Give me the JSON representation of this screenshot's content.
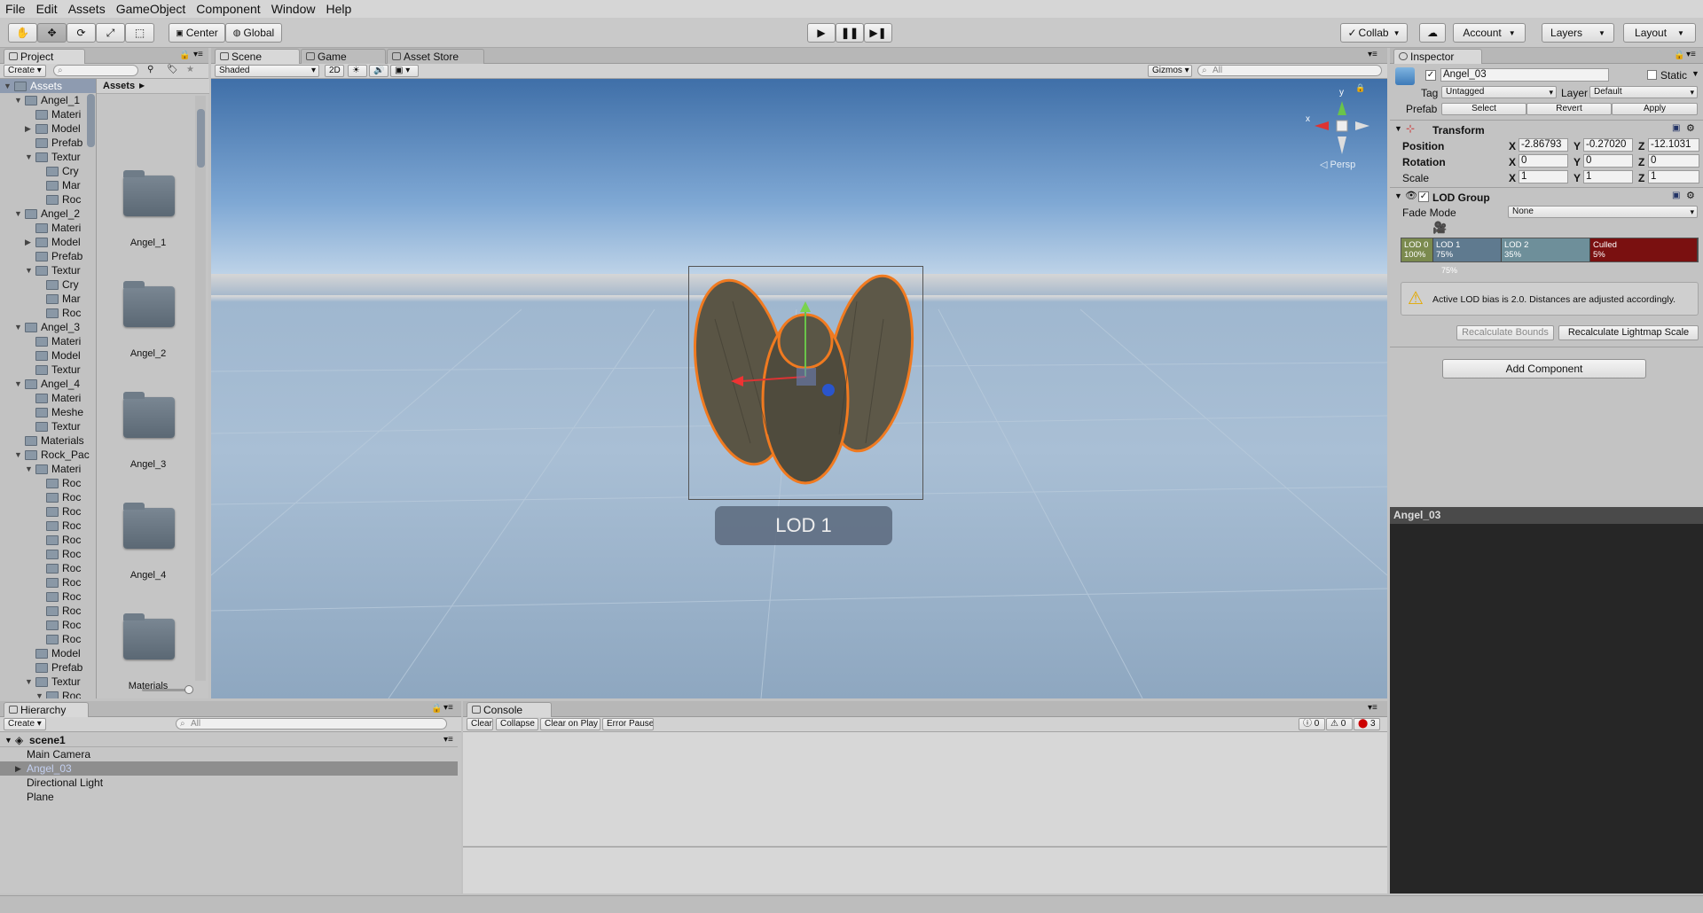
{
  "menu": [
    "File",
    "Edit",
    "Assets",
    "GameObject",
    "Component",
    "Window",
    "Help"
  ],
  "toolbar": {
    "center_label": "Center",
    "global_label": "Global",
    "collab_label": "Collab",
    "account_label": "Account",
    "layers_label": "Layers",
    "layout_label": "Layout"
  },
  "project": {
    "tab": "Project",
    "create": "Create",
    "breadcrumb": "Assets",
    "tree": [
      {
        "label": "Assets",
        "depth": 0,
        "arrow": "▼"
      },
      {
        "label": "Angel_1",
        "depth": 1,
        "arrow": "▼"
      },
      {
        "label": "Materi",
        "depth": 2,
        "arrow": ""
      },
      {
        "label": "Model",
        "depth": 2,
        "arrow": "▶"
      },
      {
        "label": "Prefab",
        "depth": 2,
        "arrow": ""
      },
      {
        "label": "Textur",
        "depth": 2,
        "arrow": "▼"
      },
      {
        "label": "Cry",
        "depth": 3,
        "arrow": ""
      },
      {
        "label": "Mar",
        "depth": 3,
        "arrow": ""
      },
      {
        "label": "Roc",
        "depth": 3,
        "arrow": ""
      },
      {
        "label": "Angel_2",
        "depth": 1,
        "arrow": "▼"
      },
      {
        "label": "Materi",
        "depth": 2,
        "arrow": ""
      },
      {
        "label": "Model",
        "depth": 2,
        "arrow": "▶"
      },
      {
        "label": "Prefab",
        "depth": 2,
        "arrow": ""
      },
      {
        "label": "Textur",
        "depth": 2,
        "arrow": "▼"
      },
      {
        "label": "Cry",
        "depth": 3,
        "arrow": ""
      },
      {
        "label": "Mar",
        "depth": 3,
        "arrow": ""
      },
      {
        "label": "Roc",
        "depth": 3,
        "arrow": ""
      },
      {
        "label": "Angel_3",
        "depth": 1,
        "arrow": "▼"
      },
      {
        "label": "Materi",
        "depth": 2,
        "arrow": ""
      },
      {
        "label": "Model",
        "depth": 2,
        "arrow": ""
      },
      {
        "label": "Textur",
        "depth": 2,
        "arrow": ""
      },
      {
        "label": "Angel_4",
        "depth": 1,
        "arrow": "▼"
      },
      {
        "label": "Materi",
        "depth": 2,
        "arrow": ""
      },
      {
        "label": "Meshe",
        "depth": 2,
        "arrow": ""
      },
      {
        "label": "Textur",
        "depth": 2,
        "arrow": ""
      },
      {
        "label": "Materials",
        "depth": 1,
        "arrow": ""
      },
      {
        "label": "Rock_Pac",
        "depth": 1,
        "arrow": "▼"
      },
      {
        "label": "Materi",
        "depth": 2,
        "arrow": "▼"
      },
      {
        "label": "Roc",
        "depth": 3,
        "arrow": ""
      },
      {
        "label": "Roc",
        "depth": 3,
        "arrow": ""
      },
      {
        "label": "Roc",
        "depth": 3,
        "arrow": ""
      },
      {
        "label": "Roc",
        "depth": 3,
        "arrow": ""
      },
      {
        "label": "Roc",
        "depth": 3,
        "arrow": ""
      },
      {
        "label": "Roc",
        "depth": 3,
        "arrow": ""
      },
      {
        "label": "Roc",
        "depth": 3,
        "arrow": ""
      },
      {
        "label": "Roc",
        "depth": 3,
        "arrow": ""
      },
      {
        "label": "Roc",
        "depth": 3,
        "arrow": ""
      },
      {
        "label": "Roc",
        "depth": 3,
        "arrow": ""
      },
      {
        "label": "Roc",
        "depth": 3,
        "arrow": ""
      },
      {
        "label": "Roc",
        "depth": 3,
        "arrow": ""
      },
      {
        "label": "Model",
        "depth": 2,
        "arrow": ""
      },
      {
        "label": "Prefab",
        "depth": 2,
        "arrow": ""
      },
      {
        "label": "Textur",
        "depth": 2,
        "arrow": "▼"
      },
      {
        "label": "Roc",
        "depth": 3,
        "arrow": "▼"
      }
    ],
    "folders": [
      "Angel_1",
      "Angel_2",
      "Angel_3",
      "Angel_4",
      "Materials"
    ]
  },
  "scene": {
    "tabs": [
      "Scene",
      "Game",
      "Asset Store"
    ],
    "shading": "Shaded",
    "mode_2d": "2D",
    "gizmos": "Gizmos",
    "search_placeholder": "All",
    "persp": "◁ Persp",
    "lod_label": "LOD 1",
    "axis_y": "y",
    "axis_x": "x"
  },
  "hierarchy": {
    "tab": "Hierarchy",
    "create": "Create",
    "search_placeholder": "All",
    "scene": "scene1",
    "items": [
      "Main Camera",
      "Angel_03",
      "Directional Light",
      "Plane"
    ]
  },
  "console": {
    "tab": "Console",
    "buttons": [
      "Clear",
      "Collapse",
      "Clear on Play",
      "Error Pause"
    ],
    "info_count": "0",
    "warn_count": "0",
    "error_count": "3"
  },
  "inspector": {
    "tab": "Inspector",
    "name": "Angel_03",
    "static": "Static",
    "tag_label": "Tag",
    "tag": "Untagged",
    "layer_label": "Layer",
    "layer": "Default",
    "prefab_label": "Prefab",
    "prefab_buttons": [
      "Select",
      "Revert",
      "Apply"
    ],
    "transform": {
      "title": "Transform",
      "position_label": "Position",
      "rotation_label": "Rotation",
      "scale_label": "Scale",
      "position": [
        "-2.86793",
        "-0.27020",
        "-12.1031"
      ],
      "rotation": [
        "0",
        "0",
        "0"
      ],
      "scale": [
        "1",
        "1",
        "1"
      ]
    },
    "lod": {
      "title": "LOD Group",
      "fade_label": "Fade Mode",
      "fade": "None",
      "levels": [
        {
          "name": "LOD 0",
          "pct": "100%",
          "color": "#7b8a4e"
        },
        {
          "name": "LOD 1",
          "pct": "75%",
          "color": "#5f7a8f"
        },
        {
          "name": "LOD 2",
          "pct": "35%",
          "color": "#6e8f9a"
        },
        {
          "name": "Culled",
          "pct": "5%",
          "color": "#7a1010"
        }
      ],
      "camera_pct": "75%",
      "warning": "Active LOD bias is 2.0. Distances are adjusted accordingly.",
      "recalc_bounds": "Recalculate Bounds",
      "recalc_lightmap": "Recalculate Lightmap Scale"
    },
    "add_component": "Add Component",
    "preview_title": "Angel_03"
  }
}
